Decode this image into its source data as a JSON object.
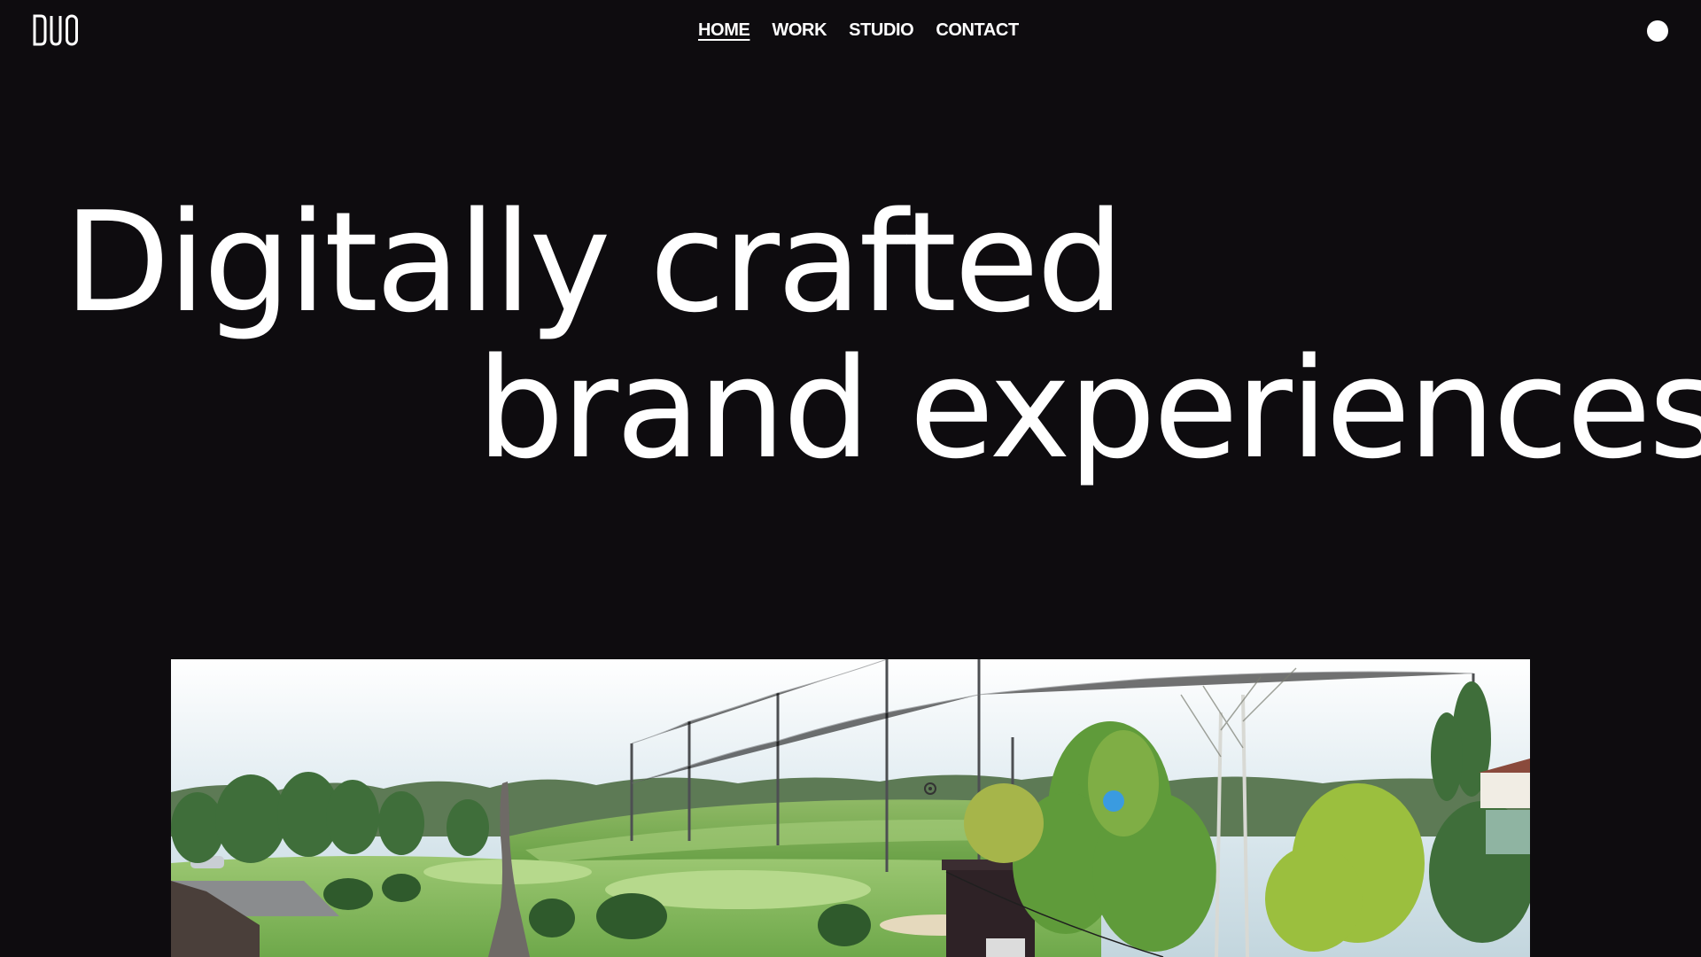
{
  "brand": {
    "logo_text": "DUO"
  },
  "nav": {
    "items": [
      {
        "label": "HOME",
        "active": true
      },
      {
        "label": "WORK",
        "active": false
      },
      {
        "label": "STUDIO",
        "active": false
      },
      {
        "label": "CONTACT",
        "active": false
      }
    ]
  },
  "menu": {
    "icon": "menu-dot-icon"
  },
  "hero": {
    "line1": "Digitally crafted",
    "line2": "brand experiences"
  },
  "media": {
    "type": "video-still",
    "scene": "golf-driving-range-aerial",
    "cursor_color": "#3a9be0"
  },
  "colors": {
    "background": "#0e0c0f",
    "text": "#ffffff"
  }
}
